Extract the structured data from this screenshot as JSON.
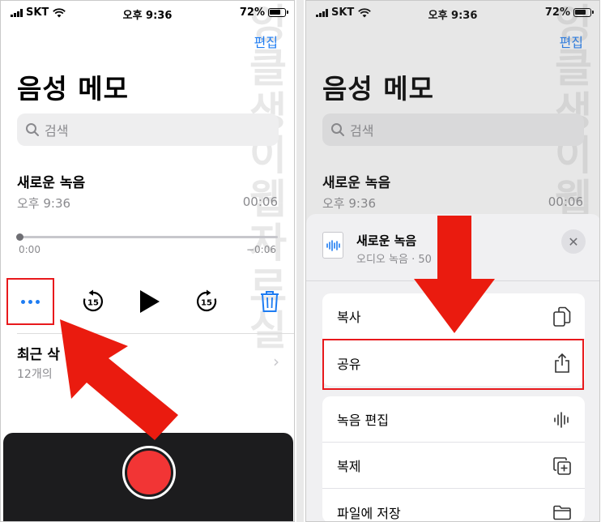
{
  "status": {
    "carrier": "SKT",
    "time": "오후 9:36",
    "battery": "72%"
  },
  "header": {
    "edit": "편집",
    "title": "음성 메모"
  },
  "search": {
    "placeholder": "검색"
  },
  "recording": {
    "title": "새로운 녹음",
    "time": "오후 9:36",
    "duration": "00:06",
    "elapsed": "0:00",
    "remaining": "−0:06"
  },
  "recent": {
    "title": "최근 삭",
    "count": "12개의"
  },
  "watermark": [
    "잉",
    "클",
    "생",
    "이",
    "웹",
    "자",
    "르",
    "실"
  ],
  "share_sheet": {
    "file_name": "새로운 녹음",
    "file_sub": "오디오 녹음 · 50",
    "actions": [
      {
        "label": "복사",
        "icon": "copy-icon"
      },
      {
        "label": "공유",
        "icon": "share-icon"
      },
      {
        "label": "녹음 편집",
        "icon": "waveform-icon"
      },
      {
        "label": "복제",
        "icon": "duplicate-icon"
      },
      {
        "label": "파일에 저장",
        "icon": "folder-icon"
      }
    ]
  },
  "colors": {
    "accent": "#1e7cf2",
    "highlight": "#e8191c",
    "record": "#f23535",
    "arrow": "#ea1b0f"
  }
}
